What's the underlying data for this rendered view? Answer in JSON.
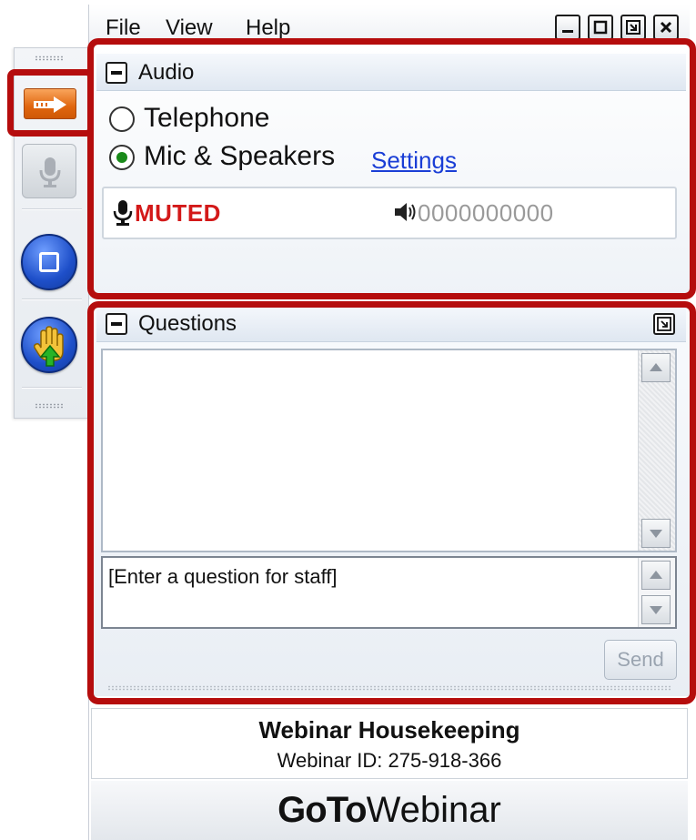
{
  "menu": {
    "file": "File",
    "view": "View",
    "help": "Help"
  },
  "audio": {
    "title": "Audio",
    "option_telephone": "Telephone",
    "option_mic": "Mic & Speakers",
    "selected": "Mic & Speakers",
    "settings_link": "Settings",
    "mute_status": "MUTED",
    "level_indicator": "0000000000"
  },
  "questions": {
    "title": "Questions",
    "input_text": "[Enter a question for staff]",
    "send_label": "Send"
  },
  "footer": {
    "title": "Webinar Housekeeping",
    "webinar_id": "Webinar ID: 275-918-366",
    "brand_bold": "GoTo",
    "brand_regular": "Webinar"
  },
  "colors": {
    "highlight": "#b50d0d",
    "muted": "#d31919",
    "link": "#1a3ed6",
    "toolbar_accent": "#e0660f",
    "round_button": "#1e4fc9"
  },
  "icons": [
    "arrow-right-icon",
    "microphone-icon",
    "screen-icon",
    "raise-hand-icon",
    "minimize-icon",
    "maximize-icon",
    "restore-icon",
    "close-icon",
    "collapse-icon",
    "popout-icon",
    "speaker-icon",
    "scroll-up-icon",
    "scroll-down-icon"
  ]
}
